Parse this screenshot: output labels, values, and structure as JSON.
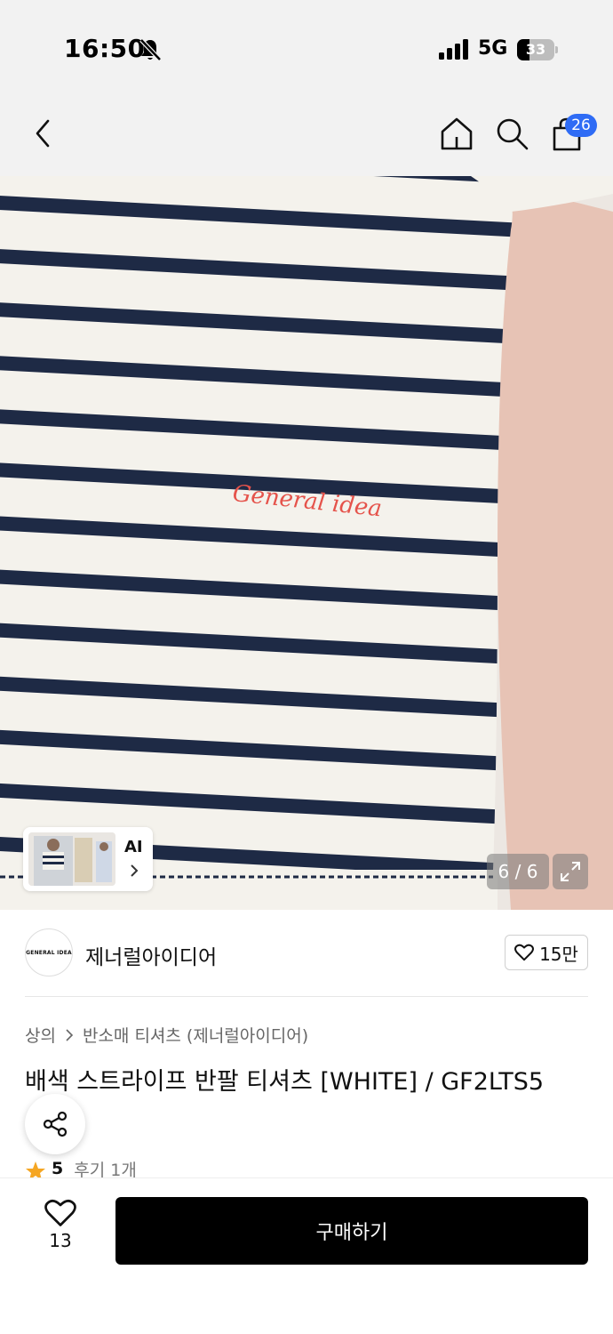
{
  "status_bar": {
    "time": "16:50",
    "network": "5G",
    "battery": "33"
  },
  "nav": {
    "cart_count": "26",
    "icons": [
      "chevron-left-icon",
      "home-icon",
      "search-icon",
      "shopping-bag-icon"
    ]
  },
  "gallery": {
    "counter": "6 / 6",
    "ai_label": "AI",
    "embroidery": "General idea"
  },
  "brand": {
    "logo_text": "GENERAL IDEA",
    "name": "제너럴아이디어",
    "likes": "15만"
  },
  "breadcrumb": [
    "상의",
    "반소매 티셔츠 (제너럴아이디어)"
  ],
  "product": {
    "title": "배색 스트라이프 반팔 티셔츠 [WHITE] / GF2LTS5"
  },
  "rating": {
    "score": "5",
    "reviews": "후기 1개"
  },
  "bottom_bar": {
    "wish_count": "13",
    "buy_label": "구매하기"
  },
  "colors": {
    "accent_badge": "#2f6cf5",
    "buy_button": "#000000",
    "star": "#f5a623",
    "stripe": "#1e2a45",
    "embroidery": "#e5534b"
  }
}
